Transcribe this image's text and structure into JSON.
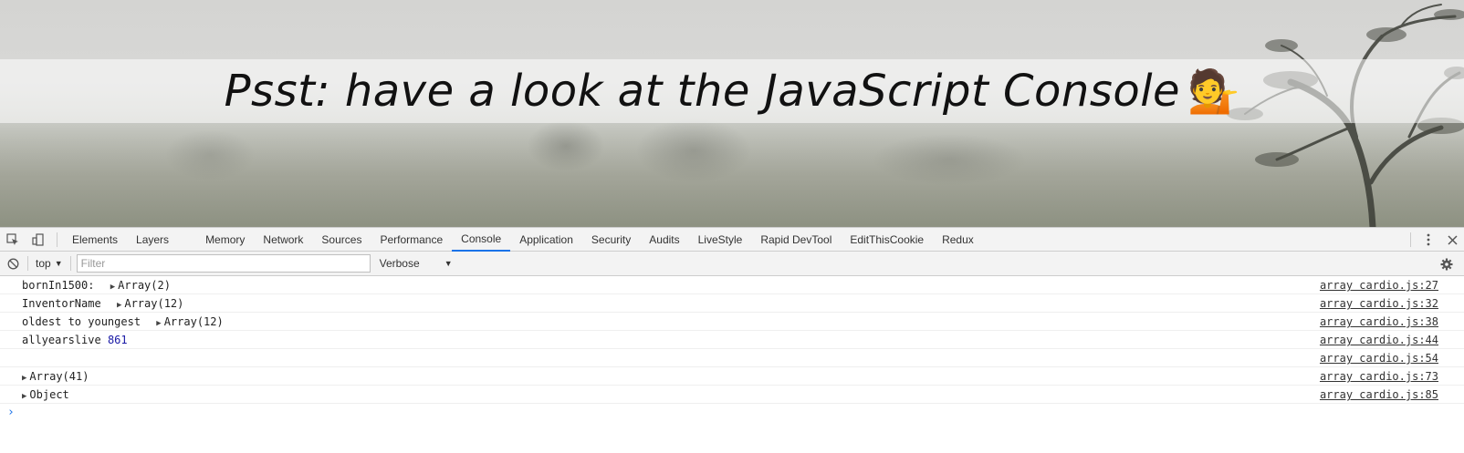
{
  "page": {
    "banner_text": "Psst: have a look at the JavaScript Console",
    "banner_emoji": "💁"
  },
  "devtools": {
    "tabs": [
      "Elements",
      "Layers",
      "Memory",
      "Network",
      "Sources",
      "Performance",
      "Console",
      "Application",
      "Security",
      "Audits",
      "LiveStyle",
      "Rapid DevTool",
      "EditThisCookie",
      "Redux"
    ],
    "active_tab": "Console",
    "toolbar": {
      "context": "top",
      "filter_placeholder": "Filter",
      "levels": "Verbose"
    },
    "messages": [
      {
        "label": "bornIn1500:",
        "value": "Array(2)",
        "expandable": true,
        "source": "array cardio.js:27"
      },
      {
        "label": "InventorName",
        "value": "Array(12)",
        "expandable": true,
        "source": "array cardio.js:32"
      },
      {
        "label": "oldest to youngest",
        "value": "Array(12)",
        "expandable": true,
        "source": "array cardio.js:38"
      },
      {
        "label": "allyearslive",
        "value": "861",
        "number": true,
        "source": "array cardio.js:44"
      },
      {
        "label": "",
        "value": "",
        "source": "array cardio.js:54"
      },
      {
        "label": "",
        "value": "Array(41)",
        "expandable": true,
        "source": "array cardio.js:73"
      },
      {
        "label": "",
        "value": "Object",
        "expandable": true,
        "source": "array cardio.js:85"
      }
    ],
    "prompt_symbol": "›",
    "colors": {
      "accent": "#1a73e8",
      "number": "#1a1aa6"
    }
  }
}
